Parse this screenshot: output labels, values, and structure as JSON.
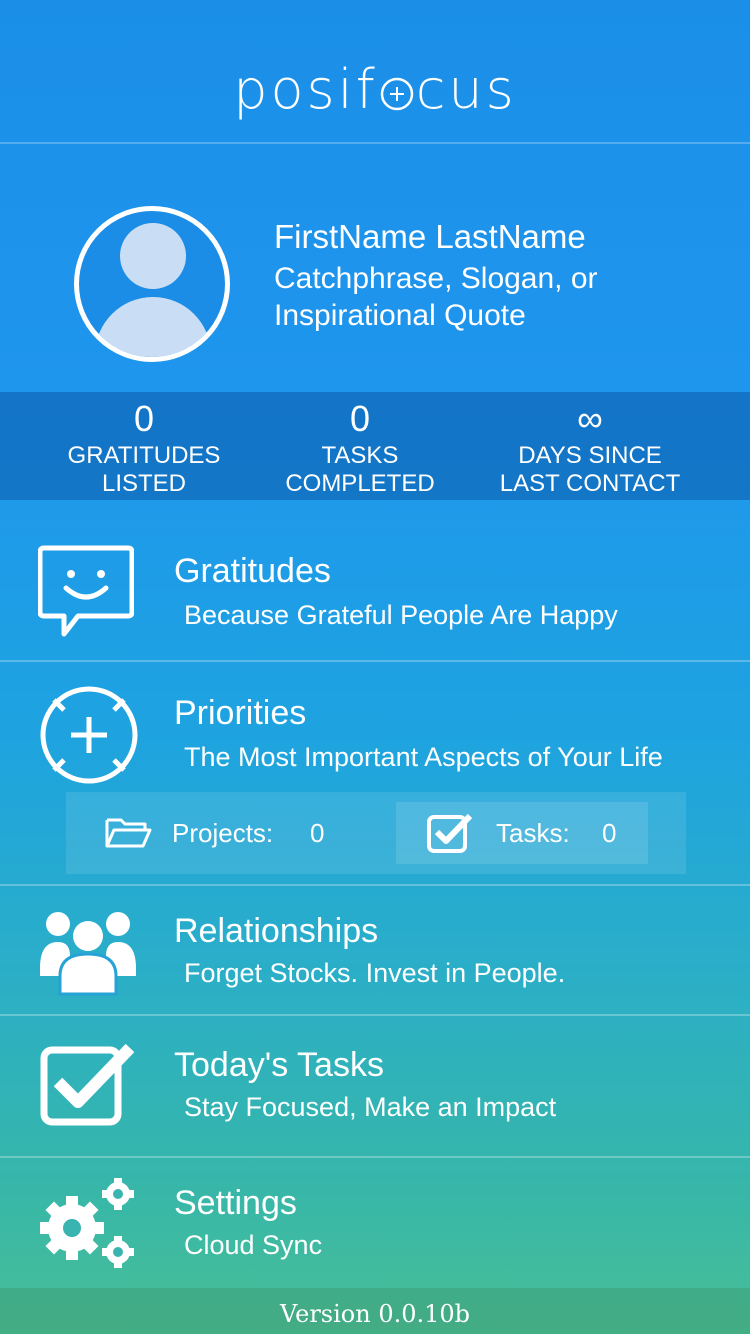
{
  "app": {
    "logo_pre": "pos",
    "logo_i": "i",
    "logo_f": "f",
    "logo_post": "cus"
  },
  "profile": {
    "name": "FirstName LastName",
    "slogan": "Catchphrase, Slogan, or Inspirational Quote"
  },
  "stats": [
    {
      "value": "0",
      "label_1": "GRATITUDES",
      "label_2": "LISTED"
    },
    {
      "value": "0",
      "label_1": "TASKS",
      "label_2": "COMPLETED"
    },
    {
      "value": "∞",
      "label_1": "DAYS SINCE",
      "label_2": "LAST CONTACT"
    }
  ],
  "menu": [
    {
      "title": "Gratitudes",
      "subtitle": "Because Grateful People Are Happy",
      "icon": "smile-chat-icon"
    },
    {
      "title": "Priorities",
      "subtitle": "The Most Important Aspects of Your Life",
      "icon": "crosshair-plus-icon"
    },
    {
      "title": "Relationships",
      "subtitle": "Forget Stocks. Invest in People.",
      "icon": "people-group-icon"
    },
    {
      "title": "Today's Tasks",
      "subtitle": "Stay Focused, Make an Impact",
      "icon": "checkbox-icon"
    },
    {
      "title": "Settings",
      "subtitle": "Cloud Sync",
      "icon": "gears-icon"
    }
  ],
  "priorities_sub": {
    "projects_label": "Projects:",
    "projects_count": "0",
    "tasks_label": "Tasks:",
    "tasks_count": "0"
  },
  "footer": {
    "version": "Version 0.0.10b"
  }
}
